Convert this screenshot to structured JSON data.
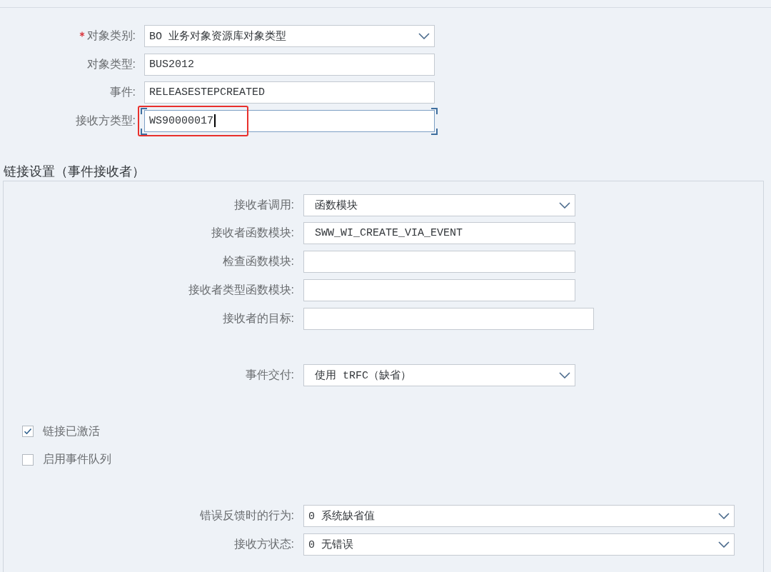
{
  "header_fields": [
    {
      "label": "对象类别:",
      "required": true,
      "kind": "dropdown",
      "value": "BO 业务对象资源库对象类型",
      "focused": false,
      "highlighted": false
    },
    {
      "label": "对象类型:",
      "required": false,
      "kind": "text",
      "value": "BUS2012",
      "focused": false,
      "highlighted": false
    },
    {
      "label": "事件:",
      "required": false,
      "kind": "text",
      "value": "RELEASESTEPCREATED",
      "focused": false,
      "highlighted": false
    },
    {
      "label": "接收方类型:",
      "required": false,
      "kind": "text",
      "value": "WS90000017",
      "focused": true,
      "highlighted": true
    }
  ],
  "section": {
    "title": "链接设置（事件接收者）",
    "receiver_fields": [
      {
        "label": "接收者调用:",
        "kind": "dropdown",
        "value": "函数模块"
      },
      {
        "label": "接收者函数模块:",
        "kind": "text",
        "value": "SWW_WI_CREATE_VIA_EVENT"
      },
      {
        "label": "检查函数模块:",
        "kind": "text"
      },
      {
        "label": "接收者类型函数模块:",
        "kind": "text"
      },
      {
        "label": "接收者的目标:",
        "kind": "text"
      }
    ],
    "delivery_fields": [
      {
        "label": "事件交付:",
        "kind": "dropdown",
        "value": "使用 tRFC（缺省）"
      }
    ],
    "checkboxes": [
      {
        "label": "链接已激活",
        "checked": true
      },
      {
        "label": "启用事件队列",
        "checked": false
      }
    ],
    "status_fields": [
      {
        "label": "错误反馈时的行为:",
        "kind": "dropdown",
        "value": "0 系统缺省值"
      },
      {
        "label": "接收方状态:",
        "kind": "dropdown",
        "value": "0 无错误"
      }
    ]
  }
}
